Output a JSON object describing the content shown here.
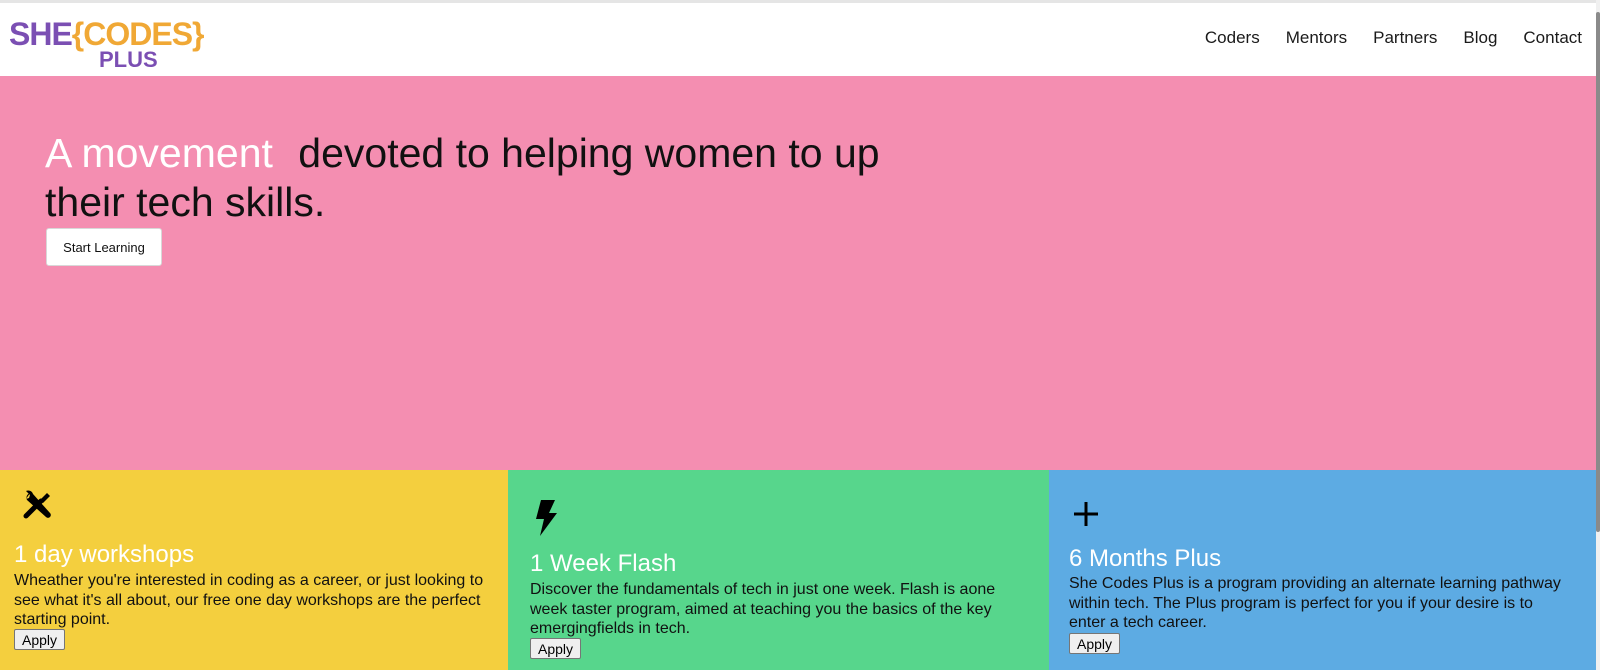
{
  "header": {
    "logo": {
      "part1": "SHE",
      "part2": "{CODES}",
      "part3": "PLUS"
    },
    "nav": [
      "Coders",
      "Mentors",
      "Partners",
      "Blog",
      "Contact"
    ]
  },
  "hero": {
    "headline_accent": "A movement",
    "headline_rest": "devoted to helping women to up their tech skills.",
    "cta_label": "Start Learning"
  },
  "programs": [
    {
      "icon": "tools-icon",
      "title": "1 day workshops",
      "description": "Wheather you're interested in coding as a career, or just looking to see what it's all about, our free one day workshops are the perfect starting point.",
      "button_label": "Apply"
    },
    {
      "icon": "lightning-bolt-icon",
      "title": "1 Week Flash",
      "description": "Discover the fundamentals of tech in just one week. Flash is aone week taster program, aimed at teaching you the basics of the key emergingfields in tech.",
      "button_label": "Apply"
    },
    {
      "icon": "plus-icon",
      "title": "6 Months Plus",
      "description": "She Codes Plus is a program providing an alternate learning pathway within tech. The Plus program is perfect for you if your desire is to enter a tech career.",
      "button_label": "Apply"
    }
  ],
  "colors": {
    "hero_bg": "#f48eb1",
    "card1_bg": "#f4cf3e",
    "card2_bg": "#57d68c",
    "card3_bg": "#5dabe3",
    "logo_purple": "#7b4fb3",
    "logo_orange": "#f0a835"
  }
}
